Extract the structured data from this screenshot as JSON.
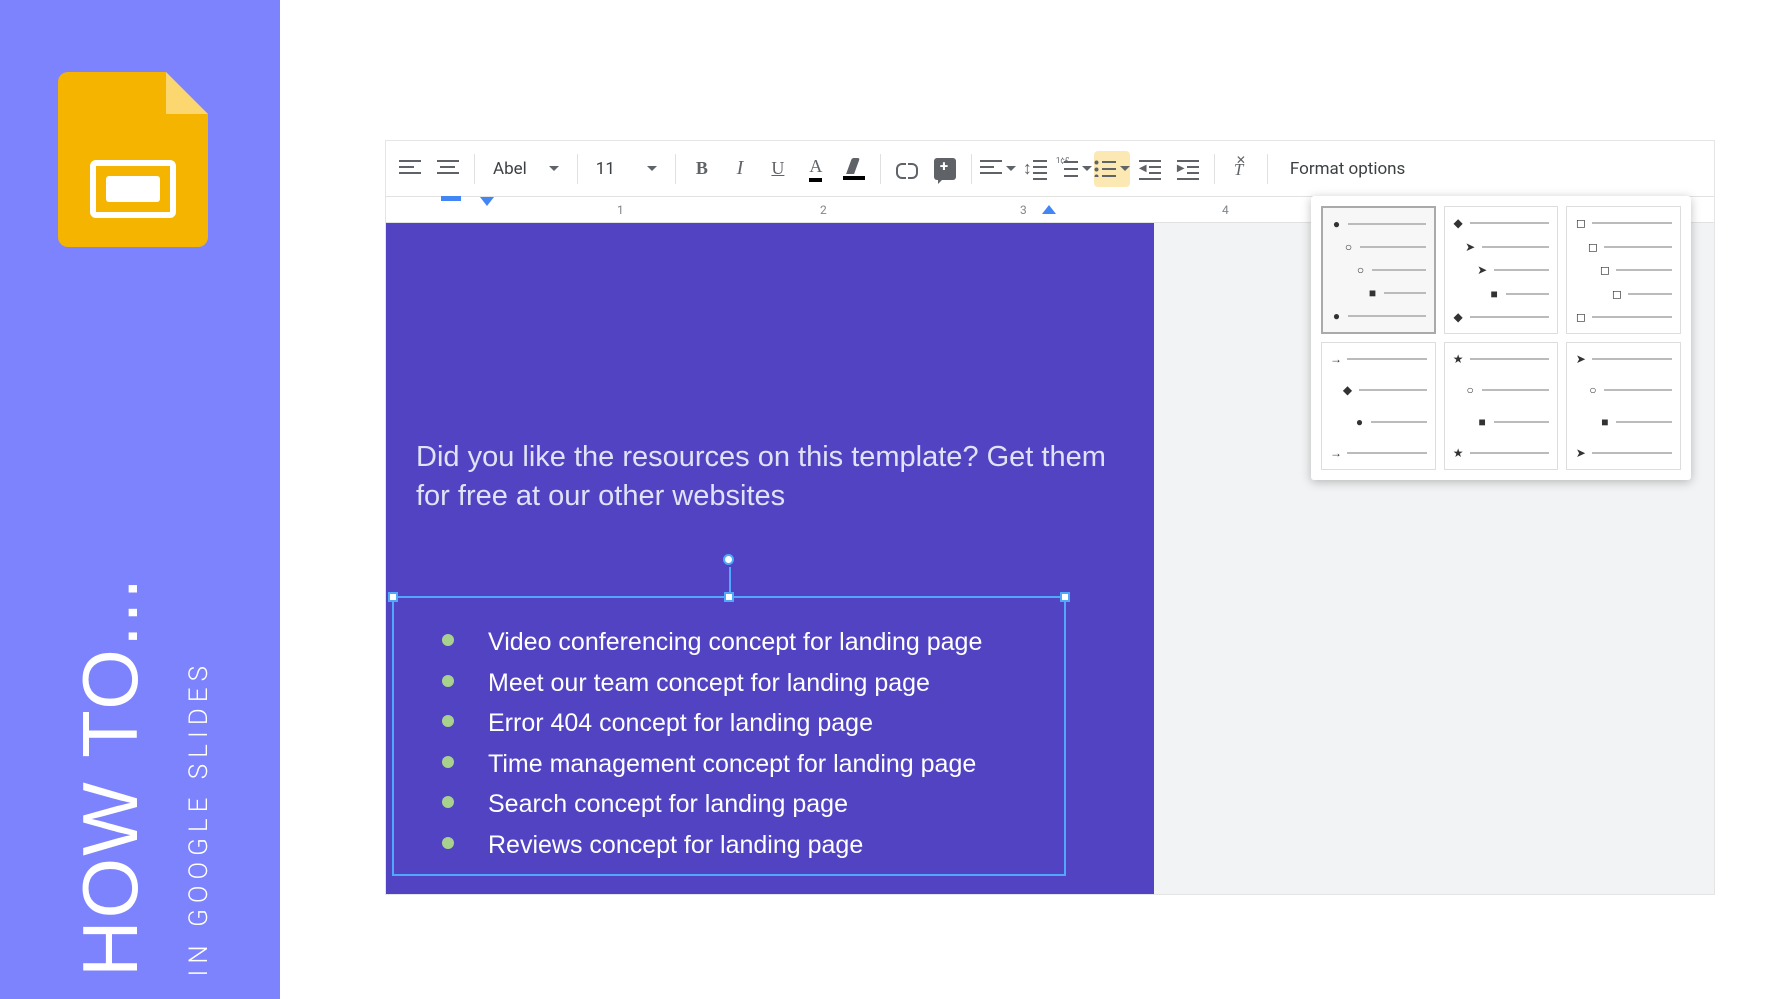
{
  "banner": {
    "howto": "HOW TO...",
    "sub": "IN GOOGLE SLIDES"
  },
  "toolbar": {
    "font": "Abel",
    "fontsize": "11",
    "bold": "B",
    "italic": "I",
    "underline": "U",
    "textcolor": "A",
    "format_options": "Format options"
  },
  "ruler": {
    "marks": [
      "1",
      "2",
      "3",
      "4"
    ]
  },
  "slide": {
    "title_line1": "Did you like the resources on this template? Get them",
    "title_line2": "for free at our other websites",
    "bullets": [
      "Video conferencing concept for landing page",
      "Meet our team concept for landing page",
      "Error 404 concept for landing page",
      "Time management concept for landing page",
      "Search concept for landing page",
      "Reviews concept for landing page"
    ]
  },
  "bullet_popup": {
    "options": [
      {
        "levels": [
          "●",
          "○",
          "○",
          "■",
          "●"
        ],
        "selected": true
      },
      {
        "levels": [
          "◆",
          "➤",
          "➤",
          "■",
          "◆"
        ],
        "selected": false
      },
      {
        "levels": [
          "◻",
          "◻",
          "◻",
          "◻",
          "◻"
        ],
        "selected": false
      },
      {
        "levels": [
          "→",
          "◆",
          "●",
          "→"
        ],
        "selected": false
      },
      {
        "levels": [
          "★",
          "○",
          "■",
          "★"
        ],
        "selected": false
      },
      {
        "levels": [
          "➤",
          "○",
          "■",
          "➤"
        ],
        "selected": false
      }
    ]
  }
}
